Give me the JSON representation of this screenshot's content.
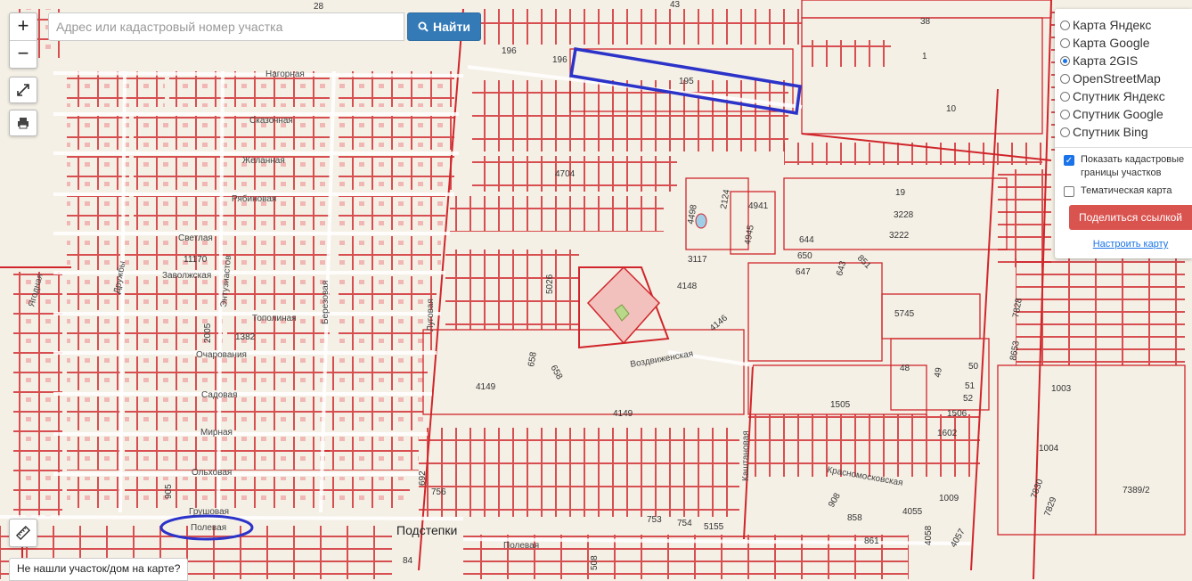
{
  "search": {
    "placeholder": "Адрес или кадастровый номер участка",
    "value": "",
    "button_label": "Найти"
  },
  "zoom": {
    "in_label": "+",
    "out_label": "−"
  },
  "icons": {
    "fullscreen": "fullscreen-icon",
    "print": "printer-icon",
    "ruler": "ruler-icon",
    "search": "search-icon"
  },
  "layers": {
    "items": [
      {
        "label": "Карта Яндекс",
        "selected": false
      },
      {
        "label": "Карта Google",
        "selected": false
      },
      {
        "label": "Карта 2GIS",
        "selected": true
      },
      {
        "label": "OpenStreetMap",
        "selected": false
      },
      {
        "label": "Спутник Яндекс",
        "selected": false
      },
      {
        "label": "Спутник Google",
        "selected": false
      },
      {
        "label": "Спутник Bing",
        "selected": false
      }
    ],
    "cadastral_label": "Показать кадастровые границы участков",
    "cadastral_checked": true,
    "thematic_label": "Тематическая карта",
    "thematic_checked": false,
    "share_label": "Поделиться ссылкой",
    "settings_label": "Настроить карту"
  },
  "not_found_label": "Не нашли участок/дом на карте?",
  "map": {
    "town": "Подстепки",
    "streets": [
      "Нагорная",
      "Сказочная",
      "Желанная",
      "Рябиновая",
      "Светлая",
      "Заволжская",
      "Тополиная",
      "Очарования",
      "Садовая",
      "Мирная",
      "Ольховая",
      "Грушовая",
      "Полевая",
      "Полевая",
      "Воздвиженская",
      "Красномосковская",
      "Каштановая",
      "Березовая",
      "Луговая",
      "Ягодная",
      "Дружбы",
      "Энтузиастов"
    ],
    "parcels": [
      "28",
      "43",
      "38",
      "196",
      "196",
      "195",
      "1",
      "10",
      "4704",
      "4941",
      "2124",
      "4498",
      "4945",
      "19",
      "3228",
      "3222",
      "644",
      "650",
      "647",
      "643",
      "851",
      "3117",
      "4148",
      "4146",
      "5026",
      "5745",
      "11170",
      "1382",
      "2005",
      "658",
      "658",
      "48",
      "49",
      "50",
      "51",
      "52",
      "4149",
      "4149",
      "1505",
      "1506",
      "1602",
      "1003",
      "1004",
      "7389/2",
      "1009",
      "4055",
      "858",
      "861",
      "4058",
      "4057",
      "908",
      "7830",
      "7829",
      "756",
      "753",
      "754",
      "5155",
      "692",
      "905",
      "8653",
      "7828",
      "84",
      "508"
    ]
  },
  "colors": {
    "parcel": "#d0262b",
    "background": "#f5f0e6",
    "highlight": "#2b33c9",
    "button": "#337ab7",
    "share": "#d9534f"
  }
}
